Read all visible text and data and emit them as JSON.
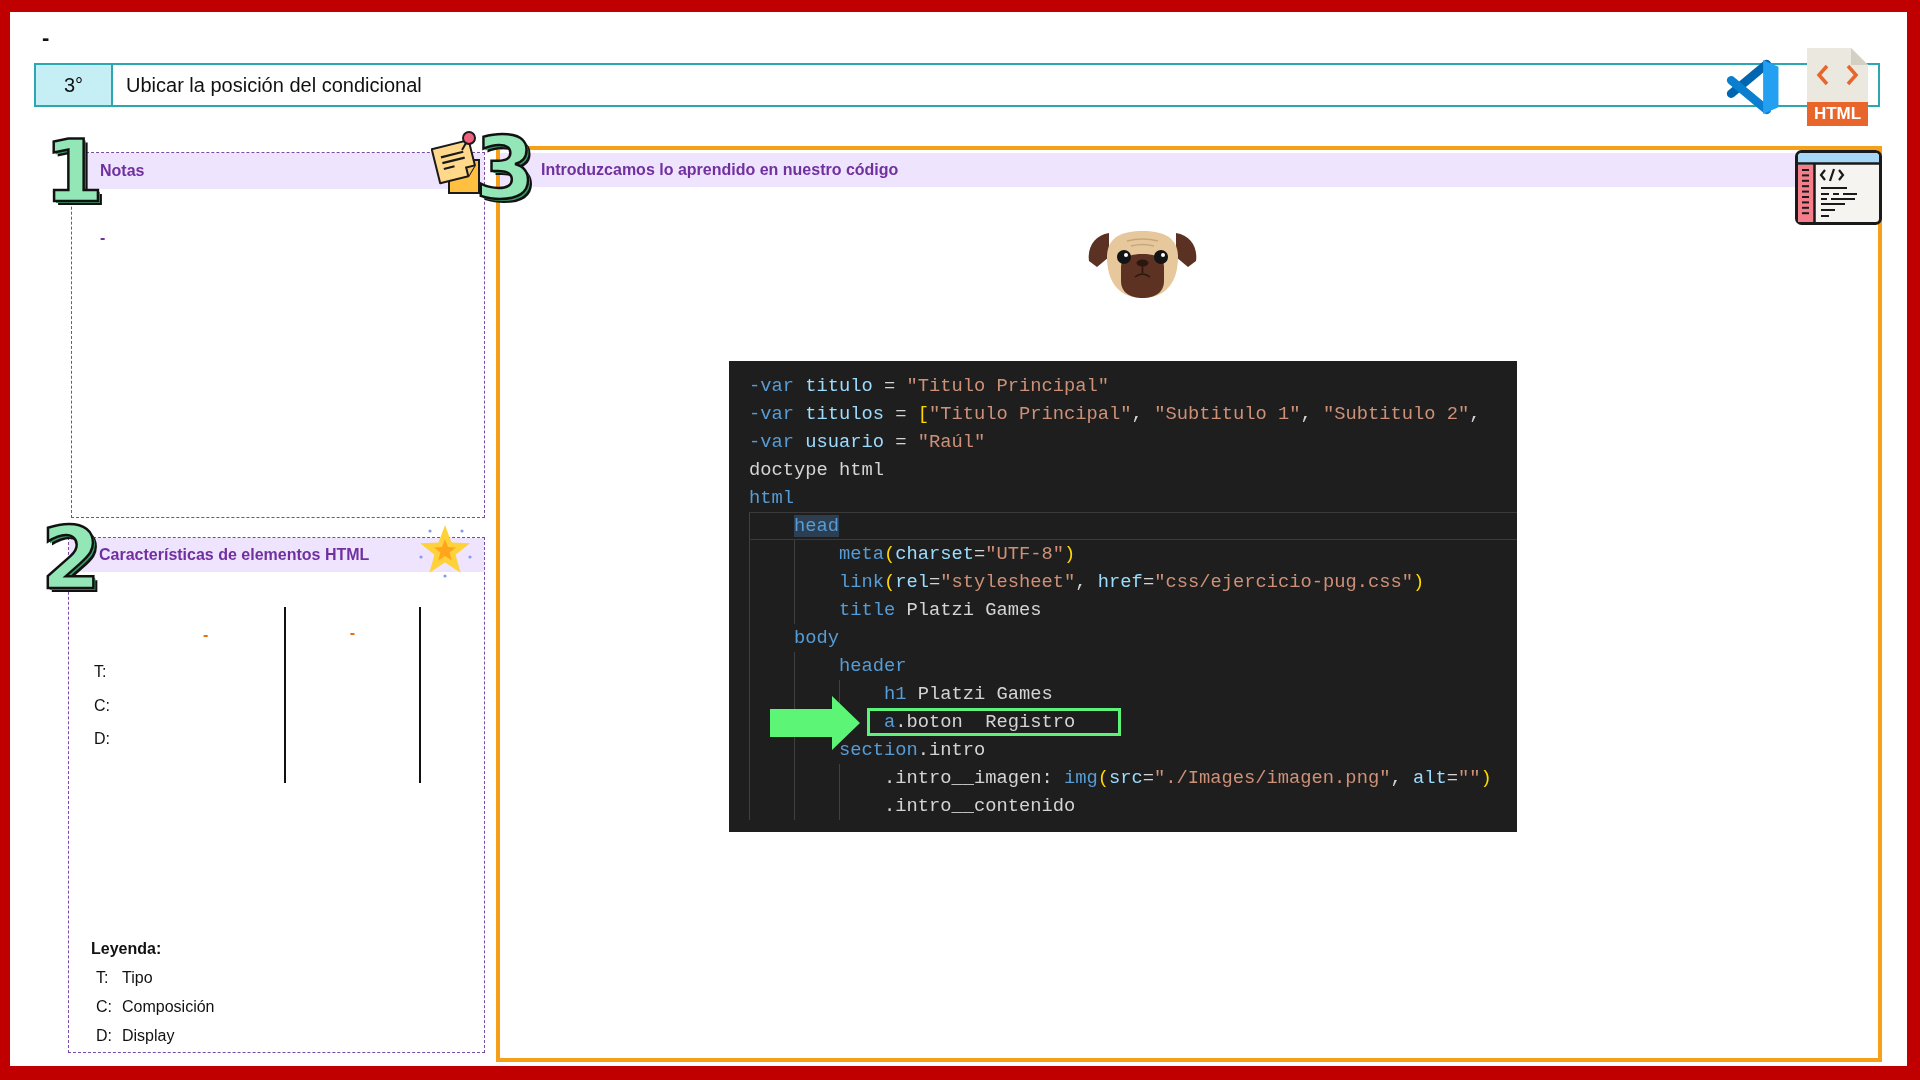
{
  "corner_mark": "-",
  "header": {
    "number": "3°",
    "title": "Ubicar la posición del condicional",
    "file_badge": "HTML"
  },
  "notes": {
    "number": "1",
    "title": "Notas",
    "items": [
      "-"
    ]
  },
  "characteristics": {
    "number": "2",
    "title": "Características de elementos HTML",
    "column_headers": [
      "-",
      "-"
    ],
    "row_labels": [
      "T:",
      "C:",
      "D:"
    ],
    "legend": {
      "title": "Leyenda:",
      "items": [
        {
          "key": "T:",
          "label": "Tipo"
        },
        {
          "key": "C:",
          "label": "Composición"
        },
        {
          "key": "D:",
          "label": "Display"
        }
      ]
    }
  },
  "practice": {
    "number": "3",
    "title": "Introduzcamos lo aprendido en nuestro código",
    "code": {
      "lines": [
        {
          "tokens": [
            {
              "kind": "keyword",
              "text": "-var "
            },
            {
              "kind": "variable",
              "text": "titulo"
            },
            {
              "kind": "plain",
              "text": " = "
            },
            {
              "kind": "string",
              "text": "\"Titulo Principal\""
            }
          ],
          "current": false,
          "marked": false
        },
        {
          "tokens": [
            {
              "kind": "keyword",
              "text": "-var "
            },
            {
              "kind": "variable",
              "text": "titulos"
            },
            {
              "kind": "plain",
              "text": " = "
            },
            {
              "kind": "bracket",
              "text": "["
            },
            {
              "kind": "string",
              "text": "\"Titulo Principal\""
            },
            {
              "kind": "plain",
              "text": ", "
            },
            {
              "kind": "string",
              "text": "\"Subtitulo 1\""
            },
            {
              "kind": "plain",
              "text": ", "
            },
            {
              "kind": "string",
              "text": "\"Subtitulo 2\""
            },
            {
              "kind": "plain",
              "text": ","
            }
          ],
          "current": false,
          "marked": false
        },
        {
          "tokens": [
            {
              "kind": "keyword",
              "text": "-var "
            },
            {
              "kind": "variable",
              "text": "usuario"
            },
            {
              "kind": "plain",
              "text": " = "
            },
            {
              "kind": "string",
              "text": "\"Raúl\""
            }
          ],
          "current": false,
          "marked": false
        },
        {
          "tokens": [
            {
              "kind": "plain",
              "text": "doctype html"
            }
          ],
          "current": false,
          "marked": false
        },
        {
          "tokens": [
            {
              "kind": "tag",
              "text": "html"
            }
          ],
          "current": false,
          "marked": false,
          "children": [
            {
              "tokens": [
                {
                  "kind": "tag",
                  "text": "head"
                }
              ],
              "current": true,
              "marked": false,
              "children": [
                {
                  "tokens": [
                    {
                      "kind": "tag",
                      "text": "meta"
                    },
                    {
                      "kind": "bracket",
                      "text": "("
                    },
                    {
                      "kind": "attr",
                      "text": "charset"
                    },
                    {
                      "kind": "plain",
                      "text": "="
                    },
                    {
                      "kind": "string",
                      "text": "\"UTF-8\""
                    },
                    {
                      "kind": "bracket",
                      "text": ")"
                    }
                  ],
                  "current": false,
                  "marked": false
                },
                {
                  "tokens": [
                    {
                      "kind": "tag",
                      "text": "link"
                    },
                    {
                      "kind": "bracket",
                      "text": "("
                    },
                    {
                      "kind": "attr",
                      "text": "rel"
                    },
                    {
                      "kind": "plain",
                      "text": "="
                    },
                    {
                      "kind": "string",
                      "text": "\"stylesheet\""
                    },
                    {
                      "kind": "plain",
                      "text": ", "
                    },
                    {
                      "kind": "attr",
                      "text": "href"
                    },
                    {
                      "kind": "plain",
                      "text": "="
                    },
                    {
                      "kind": "string",
                      "text": "\"css/ejercicio-pug.css\""
                    },
                    {
                      "kind": "bracket",
                      "text": ")"
                    }
                  ],
                  "current": false,
                  "marked": false
                },
                {
                  "tokens": [
                    {
                      "kind": "tag",
                      "text": "title"
                    },
                    {
                      "kind": "plain",
                      "text": " Platzi Games"
                    }
                  ],
                  "current": false,
                  "marked": false
                }
              ]
            },
            {
              "tokens": [
                {
                  "kind": "tag",
                  "text": "body"
                }
              ],
              "current": false,
              "marked": false,
              "children": [
                {
                  "tokens": [
                    {
                      "kind": "tag",
                      "text": "header"
                    }
                  ],
                  "current": false,
                  "marked": false,
                  "children": [
                    {
                      "tokens": [
                        {
                          "kind": "tag",
                          "text": "h1"
                        },
                        {
                          "kind": "plain",
                          "text": " Platzi Games"
                        }
                      ],
                      "current": false,
                      "marked": false
                    },
                    {
                      "tokens": [
                        {
                          "kind": "tag",
                          "text": "a"
                        },
                        {
                          "kind": "plain",
                          "text": ".boton  Registro"
                        }
                      ],
                      "current": false,
                      "marked": true
                    }
                  ]
                },
                {
                  "tokens": [
                    {
                      "kind": "tag",
                      "text": "section"
                    },
                    {
                      "kind": "plain",
                      "text": ".intro"
                    }
                  ],
                  "current": false,
                  "marked": false,
                  "children": [
                    {
                      "tokens": [
                        {
                          "kind": "plain",
                          "text": ".intro__imagen: "
                        },
                        {
                          "kind": "tag",
                          "text": "img"
                        },
                        {
                          "kind": "bracket",
                          "text": "("
                        },
                        {
                          "kind": "attr",
                          "text": "src"
                        },
                        {
                          "kind": "plain",
                          "text": "="
                        },
                        {
                          "kind": "string",
                          "text": "\"./Images/imagen.png\""
                        },
                        {
                          "kind": "plain",
                          "text": ", "
                        },
                        {
                          "kind": "attr",
                          "text": "alt"
                        },
                        {
                          "kind": "plain",
                          "text": "="
                        },
                        {
                          "kind": "string",
                          "text": "\"\""
                        },
                        {
                          "kind": "bracket",
                          "text": ")"
                        }
                      ],
                      "current": false,
                      "marked": false
                    },
                    {
                      "tokens": [
                        {
                          "kind": "plain",
                          "text": ".intro__contenido"
                        }
                      ],
                      "current": false,
                      "marked": false
                    }
                  ]
                }
              ]
            }
          ]
        }
      ]
    }
  }
}
